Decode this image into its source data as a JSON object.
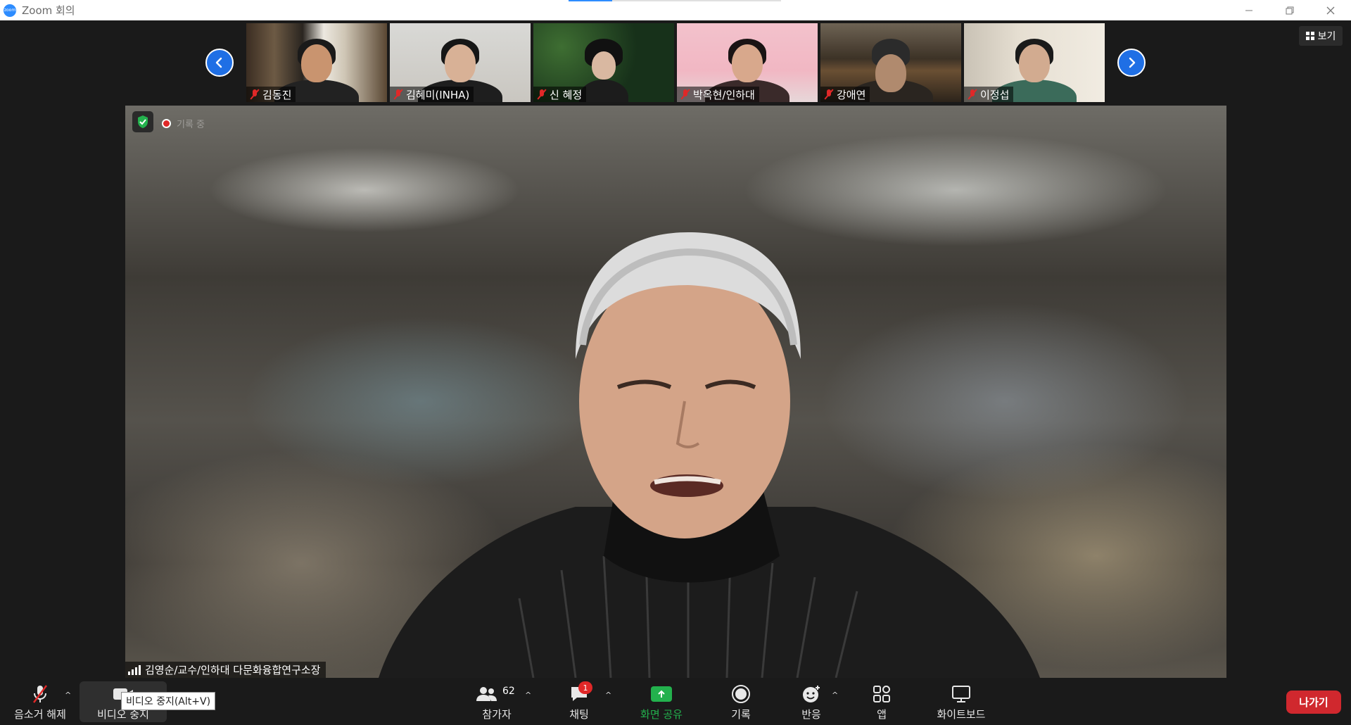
{
  "window": {
    "title": "Zoom 회의",
    "controls": [
      "minimize-icon",
      "restore-icon",
      "close-icon"
    ]
  },
  "top_strip": {
    "view_button_label": "보기",
    "thumbnails": [
      {
        "name": "김동진",
        "muted": true
      },
      {
        "name": "김혜미(INHA)",
        "muted": true
      },
      {
        "name": "신 혜정",
        "muted": true
      },
      {
        "name": "박옥현/인하대",
        "muted": true
      },
      {
        "name": "강애연",
        "muted": true
      },
      {
        "name": "이정섭",
        "muted": true
      }
    ]
  },
  "main_video": {
    "recording_label": "기록 중",
    "speaker_name": "김영순/교수/인하대 다문화융합연구소장"
  },
  "toolbar": {
    "unmute_label": "음소거 해제",
    "stop_video_label": "비디오 중지",
    "stop_video_tooltip": "비디오 중지(Alt+V)",
    "participants_label": "참가자",
    "participants_count": "62",
    "chat_label": "채팅",
    "chat_badge": "1",
    "share_screen_label": "화면 공유",
    "record_label": "기록",
    "reactions_label": "반응",
    "apps_label": "앱",
    "whiteboard_label": "화이트보드",
    "leave_label": "나가기"
  },
  "colors": {
    "accent_blue": "#2d8cff",
    "share_green": "#23b14d",
    "leave_red": "#d0282e",
    "muted_red": "#e02828"
  }
}
